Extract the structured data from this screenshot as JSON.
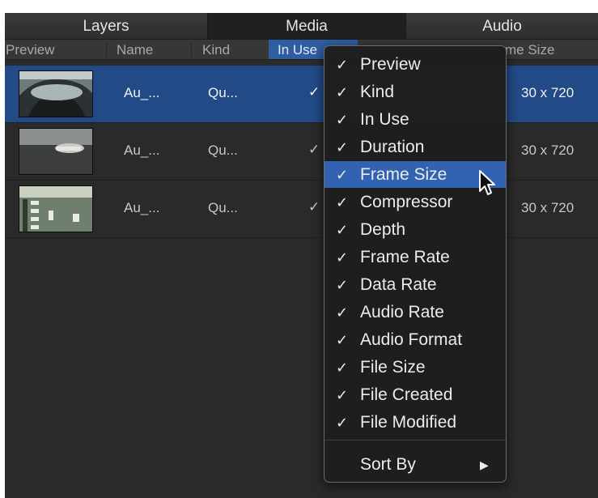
{
  "tabs": [
    {
      "label": "Layers",
      "active": false
    },
    {
      "label": "Media",
      "active": true
    },
    {
      "label": "Audio",
      "active": false
    }
  ],
  "columns": {
    "preview": "Preview",
    "name": "Name",
    "kind": "Kind",
    "in_use": "In Use",
    "frame_size": "me Size"
  },
  "rows": [
    {
      "name": "Au_...",
      "kind": "Qu...",
      "in_use": "✓",
      "frame_size": "30 x 720",
      "selected": true
    },
    {
      "name": "Au_...",
      "kind": "Qu...",
      "in_use": "✓",
      "frame_size": "30 x 720",
      "selected": false
    },
    {
      "name": "Au_...",
      "kind": "Qu...",
      "in_use": "✓",
      "frame_size": "30 x 720",
      "selected": false
    }
  ],
  "menu": {
    "items": [
      {
        "check": "✓",
        "label": "Preview"
      },
      {
        "check": "✓",
        "label": "Kind"
      },
      {
        "check": "✓",
        "label": "In Use"
      },
      {
        "check": "✓",
        "label": "Duration"
      },
      {
        "check": "✓",
        "label": "Frame Size",
        "highlighted": true
      },
      {
        "check": "✓",
        "label": "Compressor"
      },
      {
        "check": "✓",
        "label": "Depth"
      },
      {
        "check": "✓",
        "label": "Frame Rate"
      },
      {
        "check": "✓",
        "label": "Data Rate"
      },
      {
        "check": "✓",
        "label": "Audio Rate"
      },
      {
        "check": "✓",
        "label": "Audio Format"
      },
      {
        "check": "✓",
        "label": "File Size"
      },
      {
        "check": "✓",
        "label": "File Created"
      },
      {
        "check": "✓",
        "label": "File Modified"
      }
    ],
    "sort_by": "Sort By",
    "submenu_icon": "triangle-right-icon"
  },
  "colors": {
    "panel_bg": "#2a2a2a",
    "selection": "#214a87",
    "menu_highlight": "#3263b3",
    "header_selected": "#2f5da1"
  }
}
